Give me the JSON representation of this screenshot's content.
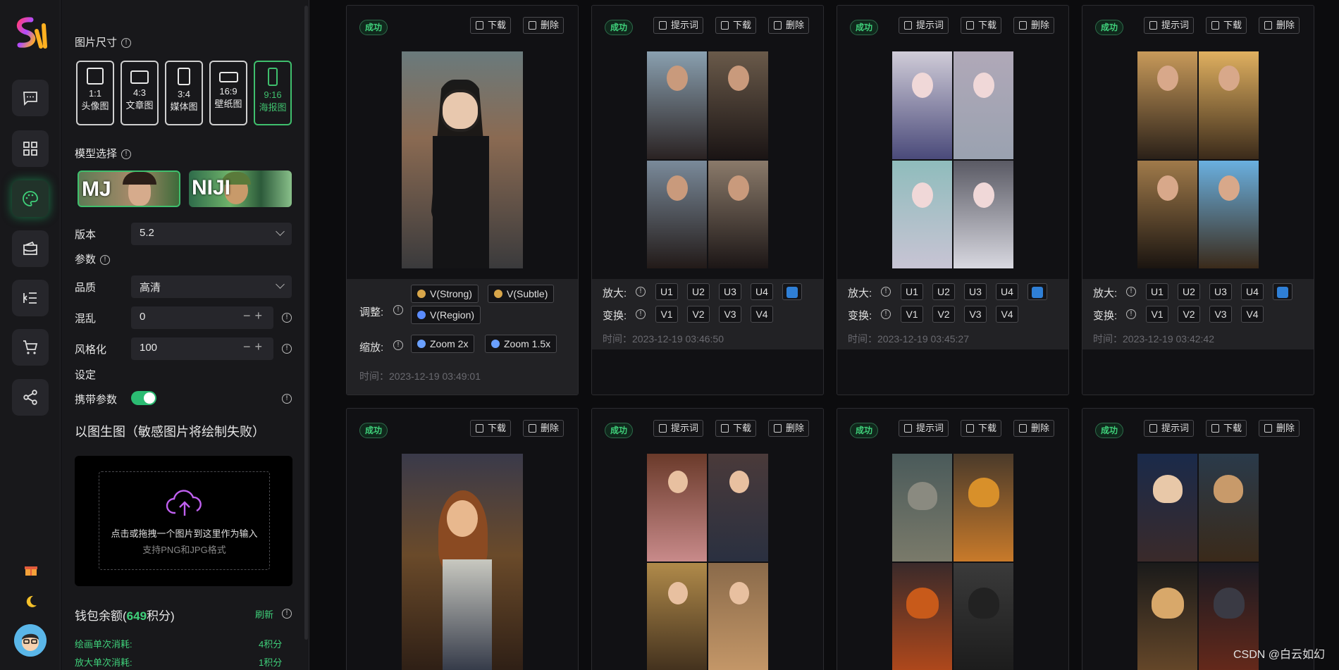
{
  "rail": {
    "icons": [
      "chat-icon",
      "grid-icon",
      "palette-icon",
      "wallet-icon",
      "list-indent-icon",
      "cart-icon",
      "share-icon",
      "gift-icon",
      "moon-icon"
    ]
  },
  "panel": {
    "image_size_label": "图片尺寸",
    "ratios": [
      {
        "ratio": "1:1",
        "name": "头像图"
      },
      {
        "ratio": "4:3",
        "name": "文章图"
      },
      {
        "ratio": "3:4",
        "name": "媒体图"
      },
      {
        "ratio": "16:9",
        "name": "壁纸图"
      },
      {
        "ratio": "9:16",
        "name": "海报图",
        "selected": true
      }
    ],
    "model_label": "模型选择",
    "models": [
      {
        "name": "MJ",
        "selected": true
      },
      {
        "name": "NIJI"
      }
    ],
    "version_label": "版本",
    "version_value": "5.2",
    "params_label": "参数",
    "quality_label": "品质",
    "quality_value": "高清",
    "chaos_label": "混乱",
    "chaos_value": "0",
    "stylize_label": "风格化",
    "stylize_value": "100",
    "settings_label": "设定",
    "carry_params_label": "携带参数",
    "carry_params_on": true,
    "img2img_title": "以图生图（敏感图片将绘制失败）",
    "upload_text": "点击或拖拽一个图片到这里作为输入",
    "upload_hint": "支持PNG和JPG格式",
    "wallet_prefix": "钱包余额(",
    "wallet_amount": "649",
    "wallet_suffix": "积分)",
    "refresh_label": "刷新",
    "draw_cost_label": "绘画单次消耗:",
    "draw_cost_value": "4积分",
    "upscale_cost_label": "放大单次消耗:",
    "upscale_cost_value": "1积分"
  },
  "labels": {
    "success": "成功",
    "prompt": "提示词",
    "download": "下载",
    "delete": "删除",
    "upscale": "放大:",
    "variation": "变换:",
    "adjust": "调整:",
    "zoom": "缩放:",
    "u": [
      "U1",
      "U2",
      "U3",
      "U4"
    ],
    "v": [
      "V1",
      "V2",
      "V3",
      "V4"
    ],
    "v_strong": "V(Strong)",
    "v_subtle": "V(Subtle)",
    "v_region": "V(Region)",
    "zoom2": "Zoom 2x",
    "zoom15": "Zoom 1.5x"
  },
  "cards": [
    {
      "time": "时间：2023-12-19 03:49:01"
    },
    {
      "time": "时间：2023-12-19 03:46:50"
    },
    {
      "time": "时间：2023-12-19 03:45:27"
    },
    {
      "time": "时间：2023-12-19 03:42:42"
    }
  ],
  "watermark": "CSDN @白云如幻",
  "colors": {
    "accent": "#3fd07a",
    "bg": "#0c0c0e",
    "panel": "#18181b",
    "card": "#111114",
    "blue": "#2f7fd6"
  }
}
